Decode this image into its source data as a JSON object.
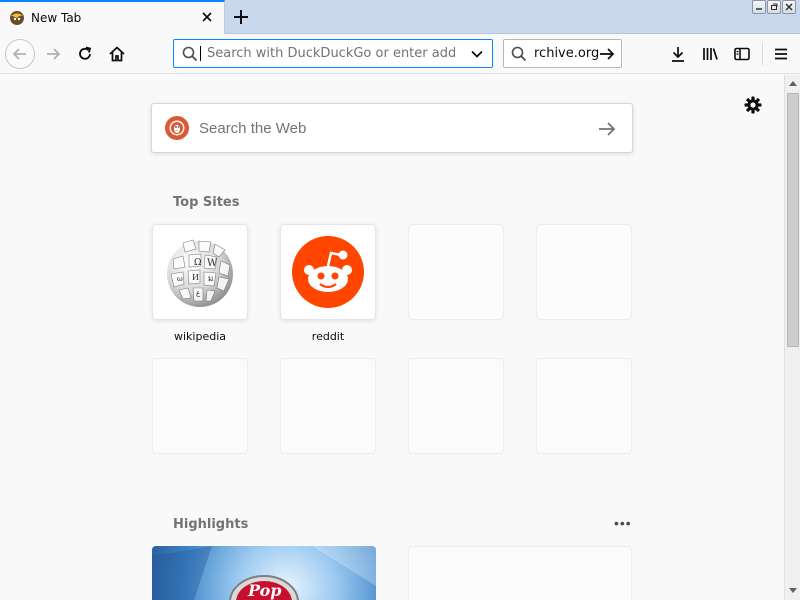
{
  "tab": {
    "title": "New Tab",
    "favicon": "firefox-icon"
  },
  "navbar": {
    "url_placeholder": "Search with DuckDuckGo or enter address",
    "search_text": "rchive.org"
  },
  "newtab": {
    "search_placeholder": "Search the Web",
    "top_sites_title": "Top Sites",
    "highlights_title": "Highlights",
    "more_label": "•••",
    "top_sites": [
      {
        "label": "wikipedia",
        "icon": "wikipedia-globe-icon"
      },
      {
        "label": "reddit",
        "icon": "reddit-alien-icon"
      },
      {
        "label": ""
      },
      {
        "label": ""
      },
      {
        "label": ""
      },
      {
        "label": ""
      },
      {
        "label": ""
      },
      {
        "label": ""
      }
    ]
  },
  "colors": {
    "accent": "#0a84ff",
    "reddit": "#ff4500",
    "ddg": "#de5833",
    "tabstrip": "#c9d8ed"
  }
}
